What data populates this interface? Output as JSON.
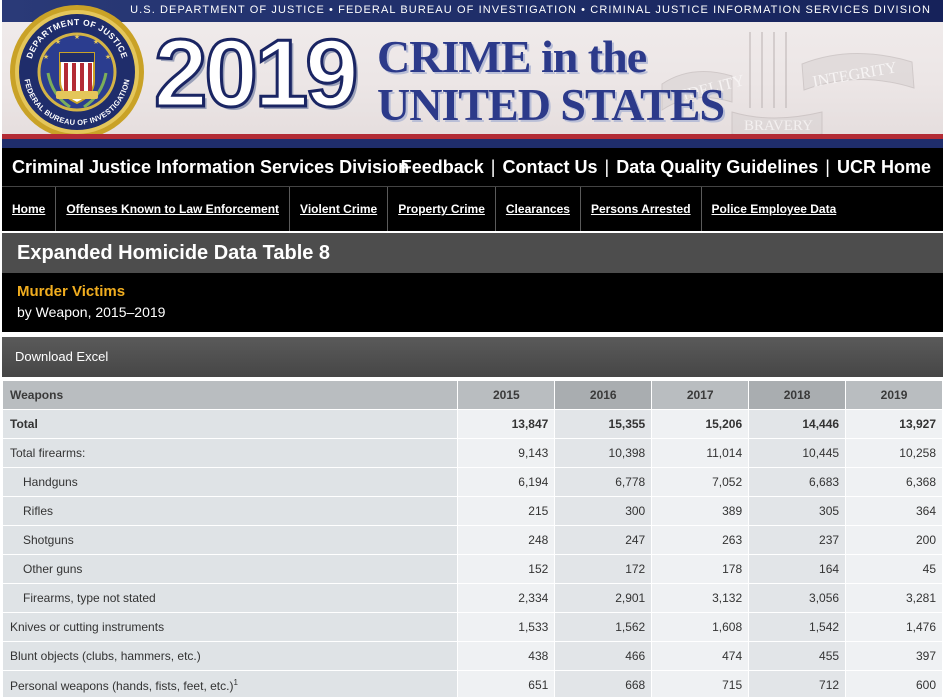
{
  "header": {
    "agency_line": "U.S. DEPARTMENT OF JUSTICE • FEDERAL BUREAU OF INVESTIGATION • CRIMINAL JUSTICE INFORMATION SERVICES DIVISION",
    "year": "2019",
    "title_line1": "CRIME in the",
    "title_line2": "UNITED STATES",
    "seal_top_text": "DEPARTMENT OF JUSTICE",
    "seal_bottom_text": "FEDERAL BUREAU OF INVESTIGATION",
    "motto_fidelity": "FIDELITY",
    "motto_bravery": "BRAVERY",
    "motto_integrity": "INTEGRITY"
  },
  "division_bar": {
    "name": "Criminal Justice Information Services Division",
    "links": [
      "Feedback",
      "Contact Us",
      "Data Quality Guidelines",
      "UCR Home"
    ],
    "separator": "|"
  },
  "nav": [
    "Home",
    "Offenses Known to Law Enforcement",
    "Violent Crime",
    "Property Crime",
    "Clearances",
    "Persons Arrested",
    "Police Employee Data"
  ],
  "page": {
    "table_heading": "Expanded Homicide Data Table 8",
    "subtitle_main": "Murder Victims",
    "subtitle_sub": "by Weapon, 2015–2019",
    "download_label": "Download Excel"
  },
  "table": {
    "columns": [
      "Weapons",
      "2015",
      "2016",
      "2017",
      "2018",
      "2019"
    ],
    "rows": [
      {
        "label": "Total",
        "values": [
          "13,847",
          "15,355",
          "15,206",
          "14,446",
          "13,927"
        ]
      },
      {
        "label": "Total firearms:",
        "values": [
          "9,143",
          "10,398",
          "11,014",
          "10,445",
          "10,258"
        ]
      },
      {
        "label": "Handguns",
        "values": [
          "6,194",
          "6,778",
          "7,052",
          "6,683",
          "6,368"
        ]
      },
      {
        "label": "Rifles",
        "values": [
          "215",
          "300",
          "389",
          "305",
          "364"
        ]
      },
      {
        "label": "Shotguns",
        "values": [
          "248",
          "247",
          "263",
          "237",
          "200"
        ]
      },
      {
        "label": "Other guns",
        "values": [
          "152",
          "172",
          "178",
          "164",
          "45"
        ]
      },
      {
        "label": "Firearms, type not stated",
        "values": [
          "2,334",
          "2,901",
          "3,132",
          "3,056",
          "3,281"
        ]
      },
      {
        "label": "Knives or cutting instruments",
        "values": [
          "1,533",
          "1,562",
          "1,608",
          "1,542",
          "1,476"
        ]
      },
      {
        "label": "Blunt objects (clubs, hammers, etc.)",
        "values": [
          "438",
          "466",
          "474",
          "455",
          "397"
        ]
      },
      {
        "label": "Personal weapons (hands, fists, feet, etc.)",
        "footnote": "1",
        "values": [
          "651",
          "668",
          "715",
          "712",
          "600"
        ]
      }
    ]
  },
  "colors": {
    "brand_navy": "#1f2d6b",
    "brand_red": "#b32b35",
    "title_blue": "#2c3a8a",
    "subtitle_gold": "#f0ad1f"
  }
}
